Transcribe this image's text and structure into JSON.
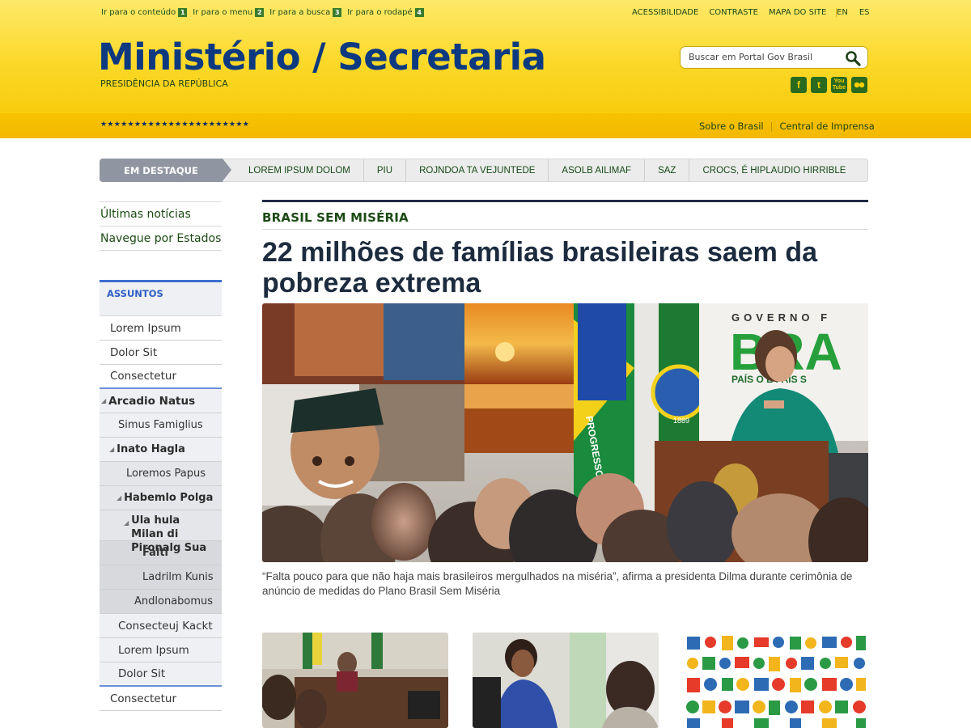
{
  "header": {
    "access_links": [
      {
        "label": "Ir para o conteúdo",
        "num": "1"
      },
      {
        "label": "Ir para o menu",
        "num": "2"
      },
      {
        "label": "Ir para a busca",
        "num": "3"
      },
      {
        "label": "Ir para o rodapé",
        "num": "4"
      }
    ],
    "top_links": [
      "ACESSIBILIDADE",
      "CONTRASTE",
      "MAPA DO SITE"
    ],
    "languages": [
      "EN",
      "ES"
    ],
    "title": "Ministério / Secretaria",
    "subtitle": "PRESIDÊNCIA DA REPÚBLICA",
    "search_placeholder": "Buscar em Portal Gov Brasil",
    "social_icons": [
      "facebook-icon",
      "twitter-icon",
      "youtube-icon",
      "flickr-icon"
    ],
    "stars": "★★★★★★★★★★★★★★★★★★★★★★",
    "band_links": [
      "Sobre o Brasil",
      "Central de Imprensa"
    ]
  },
  "destaque": {
    "label": "EM DESTAQUE",
    "items": [
      "LOREM IPSUM DOLOM",
      "PIU",
      "ROJNDOA TA VEJUNTEDE",
      "ASOLB AILIMAF",
      "SAZ",
      "CROCS, É HIPLAUDIO HIRRIBLE"
    ]
  },
  "sidebar": {
    "top_links": [
      "Últimas notícias",
      "Navegue por Estados"
    ],
    "assuntos_title": "ASSUNTOS",
    "menu": {
      "m0": "Lorem Ipsum",
      "m1": "Dolor Sit",
      "m2": "Consectetur",
      "m3": "Arcadio Natus",
      "m4": "Simus Famiglius",
      "m5": "Inato Hagla",
      "m6": "Loremos Papus",
      "m7": "Habemlo Polga",
      "m8": "Ula hula Milan di Pironalg Sua",
      "m9": "Falti",
      "m10": "Ladrilm Kunis",
      "m11": "Andlonabomus",
      "m12": "Consecteuj Kackt",
      "m13": "Lorem Ipsum",
      "m14": "Dolor Sit",
      "m15": "Consectetur"
    }
  },
  "article": {
    "kicker": "BRASIL SEM MISÉRIA",
    "headline": "22 milhões de famílias brasileiras saem da pobreza extrema",
    "caption": "“Falta pouco para que não haja mais brasileiros mergulhados na miséria”, afirma a presidenta Dilma durante cerimônia de anúncio de medidas do Plano Brasil Sem Miséria",
    "banner_top": "GOVERNO F",
    "banner_word": "BRA",
    "banner_slogan": "PAÍS   O É PAÍS S",
    "flag_word": "PROGRESSO",
    "flag_year": "1889"
  },
  "colors": {
    "header_yellow": "#fbd929",
    "title_blue": "#0c3980",
    "green_link": "#1b4a13",
    "assuntos_blue": "#2f5dc5"
  }
}
